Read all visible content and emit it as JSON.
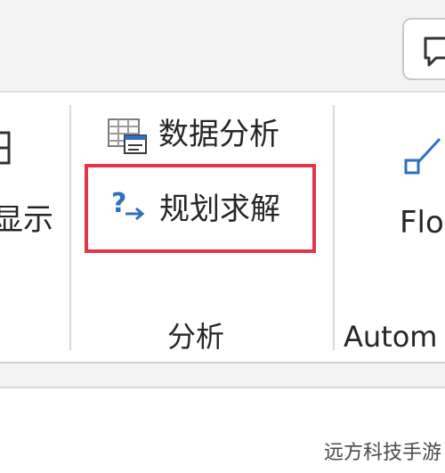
{
  "ribbon": {
    "left_group": {
      "partial_label": "显示"
    },
    "analysis_group": {
      "label": "分析",
      "data_analysis_label": "数据分析",
      "solver_label": "规划求解"
    },
    "automate_group": {
      "label": "Autom",
      "flow_label": "Flo"
    }
  },
  "watermark": "远方科技手游",
  "colors": {
    "highlight": "#e0354a",
    "accent_blue": "#2e6fbf",
    "toolbar_bg": "#f3f3f3"
  }
}
